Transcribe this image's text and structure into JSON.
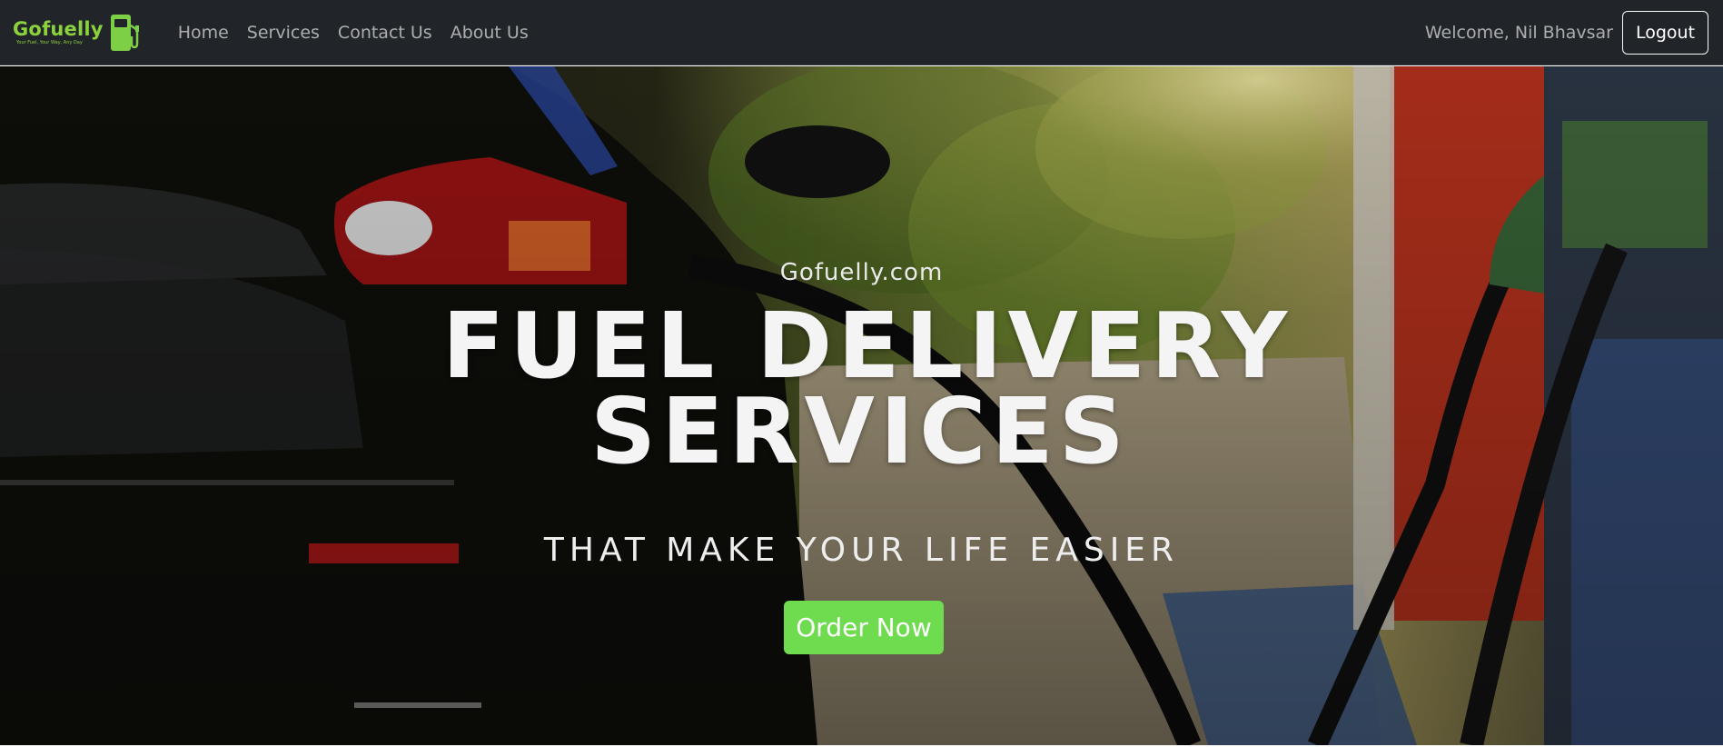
{
  "brand": {
    "name": "Gofuelly",
    "tagline": "Your Fuel, Your Way, Any Day",
    "accent_color": "#8bd13e",
    "icon": "fuel-pump-icon"
  },
  "nav": {
    "links": [
      "Home",
      "Services",
      "Contact Us",
      "About Us"
    ]
  },
  "user": {
    "welcome_text": "Welcome, Nil Bhavsar",
    "logout_label": "Logout"
  },
  "hero": {
    "site_label": "Gofuelly.com",
    "title_line_1": "FUEL DELIVERY",
    "title_line_2": "SERVICES",
    "tagline": "THAT MAKE YOUR LIFE EASIER",
    "cta_label": "Order Now",
    "cta_color": "#6fdc4f"
  }
}
